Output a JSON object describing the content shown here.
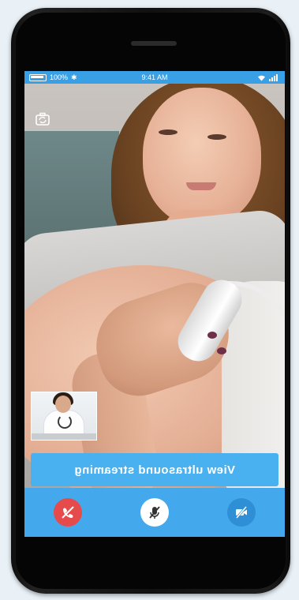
{
  "status_bar": {
    "signal": "100%",
    "bluetooth": "✱",
    "time": "9:41 AM",
    "wifi_icon": "wifi-icon"
  },
  "video": {
    "switch_camera_icon": "switch-camera-icon",
    "self_view_label": "doctor self view"
  },
  "view_button": {
    "label": "View ultrasound streaming"
  },
  "controls": {
    "end_call_icon": "end-call-icon",
    "mute_mic_icon": "mic-off-icon",
    "video_off_icon": "video-off-icon"
  },
  "colors": {
    "accent": "#43a9ec",
    "button": "#49b1ef",
    "end_call": "#e64b4b"
  }
}
